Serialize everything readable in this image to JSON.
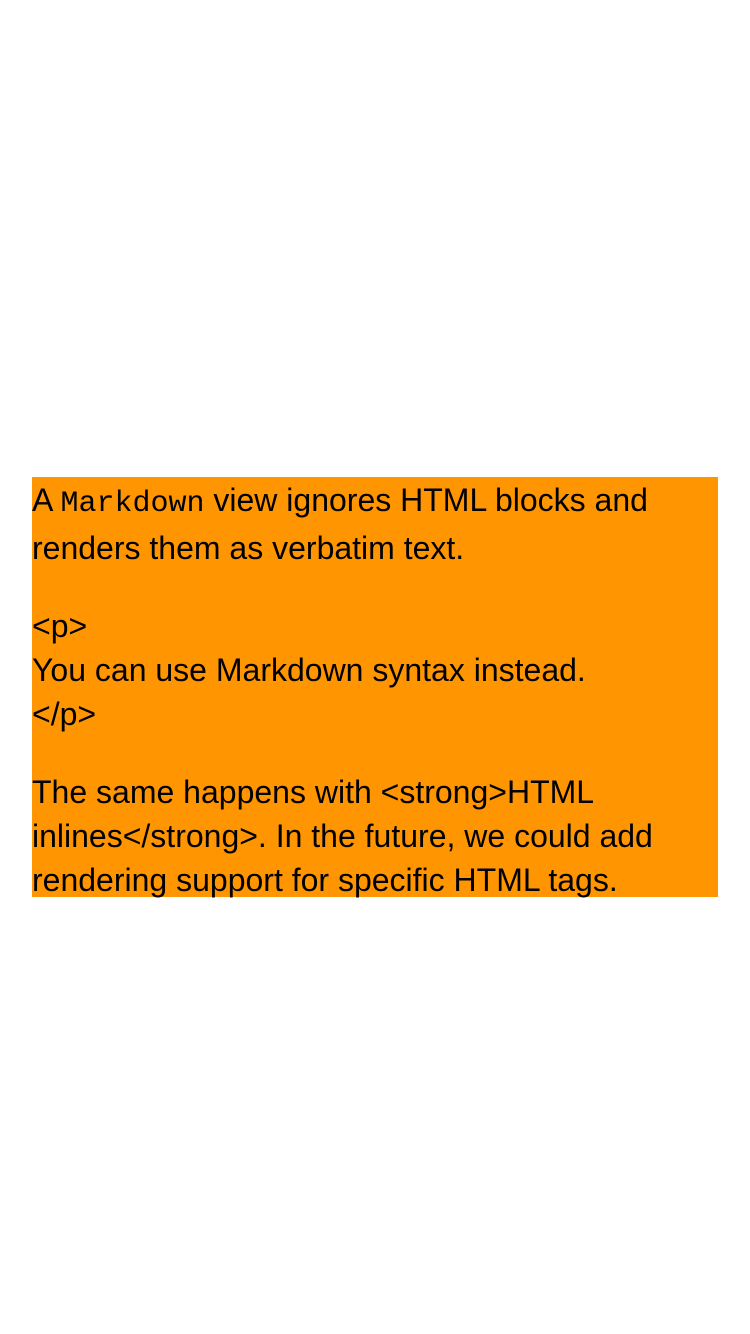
{
  "markdown_view": {
    "background_color": "#ff9500",
    "paragraph1": {
      "prefix": "A ",
      "code": "Markdown",
      "suffix": " view ignores HTML blocks and renders them as verbatim text."
    },
    "html_block": {
      "open_tag": "<p>",
      "content": "You can use Markdown syntax instead.",
      "close_tag": "</p>"
    },
    "paragraph2": "The same happens with <strong>HTML inlines</strong>. In the future, we could add rendering support for specific HTML tags."
  }
}
